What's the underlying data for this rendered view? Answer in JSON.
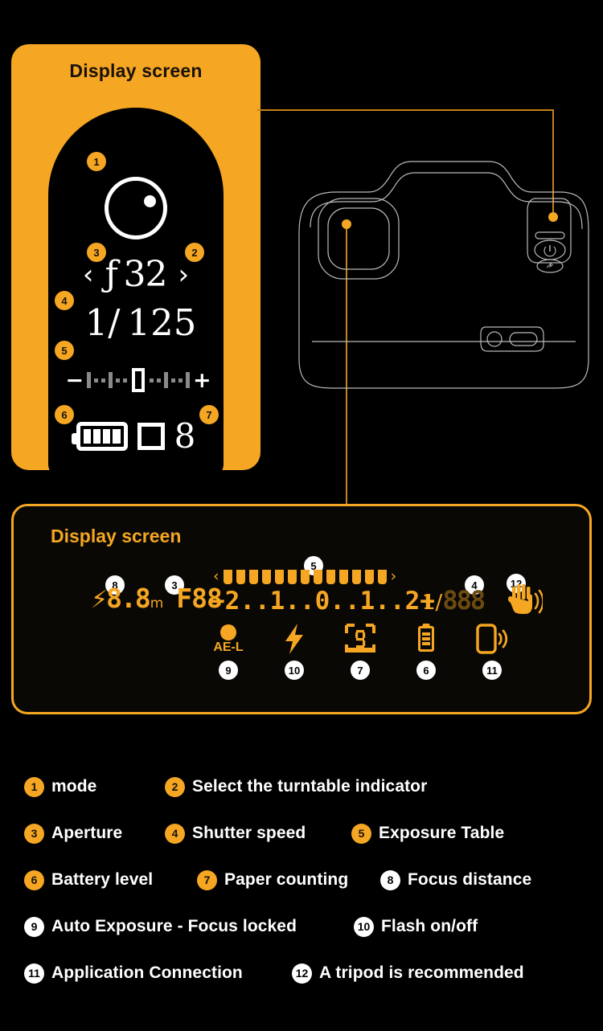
{
  "panels": {
    "top": {
      "title": "Display screen",
      "lcd": {
        "mode_icon": "mode-dial-icon",
        "aperture_prev": "‹",
        "aperture_value": "ƒ 32",
        "aperture_next": "›",
        "shutter_value": "1/ 125",
        "exposure_minus": "−",
        "exposure_plus": "+",
        "battery_icon": "battery-full-icon",
        "paper_icon": "paper-square-icon",
        "paper_count": "8"
      },
      "markers": [
        "1",
        "2",
        "3",
        "4",
        "5",
        "6",
        "7"
      ]
    },
    "bottom": {
      "title": "Display screen",
      "lcd": {
        "flash_prefix": "⚡",
        "focus_value": "8.8",
        "focus_unit": "m",
        "aperture_seg": "F88",
        "exposure_numbers": "−2..1..0..1..2+",
        "shutter_prefix": "1/",
        "shutter_value": "888",
        "shake_icon": "hand-shake-icon",
        "bar_left_arrow": "‹",
        "bar_right_arrow": "›",
        "bar_tick_count": 13
      },
      "icons": [
        {
          "name": "ae-lock-icon",
          "label": "AE-L",
          "marker": "9"
        },
        {
          "name": "flash-bolt-icon",
          "label": "",
          "marker": "10"
        },
        {
          "name": "frame-counter-icon",
          "label": "",
          "marker": "7"
        },
        {
          "name": "battery-icon",
          "label": "",
          "marker": "6"
        },
        {
          "name": "phone-connect-icon",
          "label": "",
          "marker": "11"
        }
      ],
      "markers_top": [
        "8",
        "3",
        "5",
        "4",
        "12"
      ]
    }
  },
  "camera": {
    "art_name": "camera-back-line-drawing",
    "callout_dots": [
      "shutter-button-dot",
      "viewfinder-dot"
    ]
  },
  "legend": {
    "rows": [
      [
        {
          "num": "1",
          "style": "orange",
          "label": "mode"
        },
        {
          "num": "2",
          "style": "orange",
          "label": "Select the turntable indicator"
        }
      ],
      [
        {
          "num": "3",
          "style": "orange",
          "label": "Aperture"
        },
        {
          "num": "4",
          "style": "orange",
          "label": "Shutter speed"
        },
        {
          "num": "5",
          "style": "orange",
          "label": "Exposure Table"
        }
      ],
      [
        {
          "num": "6",
          "style": "orange",
          "label": "Battery level"
        },
        {
          "num": "7",
          "style": "orange",
          "label": "Paper counting"
        },
        {
          "num": "8",
          "style": "white",
          "label": "Focus distance"
        }
      ],
      [
        {
          "num": "9",
          "style": "white",
          "label": "Auto Exposure - Focus locked"
        },
        {
          "num": "10",
          "style": "white",
          "label": "Flash on/off"
        }
      ],
      [
        {
          "num": "11",
          "style": "white",
          "label": "Application Connection"
        },
        {
          "num": "12",
          "style": "white",
          "label": "A tripod is recommended"
        }
      ]
    ]
  },
  "colors": {
    "accent": "#F5A623",
    "background": "#000000",
    "lcd_text": "#FFFFFF",
    "leader": "#C5821B"
  }
}
